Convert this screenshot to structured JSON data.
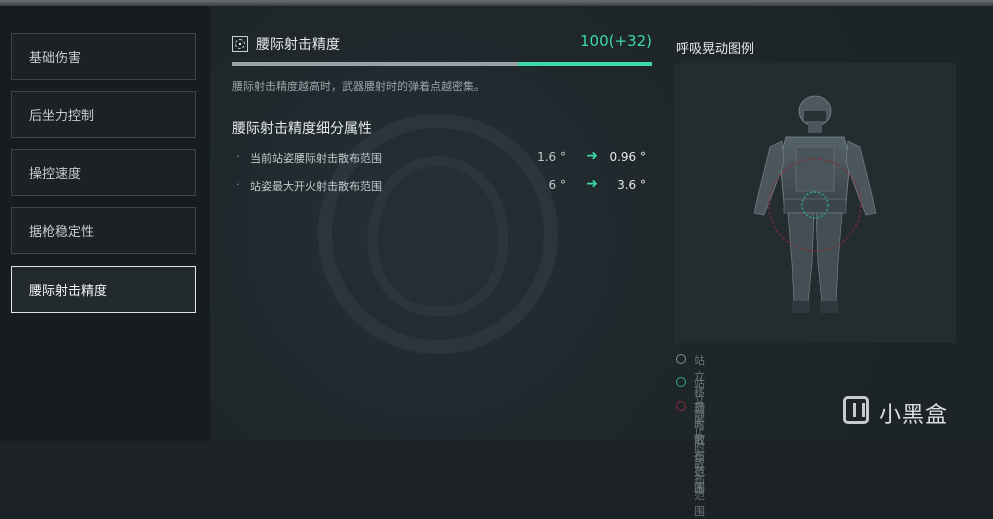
{
  "sidebar": {
    "items": [
      {
        "label": "基础伤害"
      },
      {
        "label": "后坐力控制"
      },
      {
        "label": "操控速度"
      },
      {
        "label": "据枪稳定性"
      },
      {
        "label": "腰际射击精度"
      }
    ],
    "active_index": 4
  },
  "stat": {
    "title": "腰际射击精度",
    "value": "100(+32)",
    "base_fraction": 0.68,
    "total_fraction": 1.0,
    "description": "腰际射击精度越高时，武器腰射时的弹着点越密集。"
  },
  "details": {
    "title": "腰际射击精度细分属性",
    "rows": [
      {
        "bullet": "·",
        "label": "当前站姿腰际射击散布范围",
        "old": "1.6 °",
        "arrow": "➜",
        "new": "0.96 °"
      },
      {
        "bullet": "·",
        "label": "站姿最大开火射击散布范围",
        "old": "6 °",
        "arrow": "➜",
        "new": "3.6 °"
      }
    ]
  },
  "legend": {
    "title": "呼吸晃动图例",
    "items": [
      {
        "label": "站立移动时散布范围",
        "color": "#8a9297"
      },
      {
        "label": "站立静止时散布范围",
        "color": "#2fa683"
      },
      {
        "label": "最大散布范围",
        "color": "#8a2b34"
      }
    ]
  },
  "watermark": {
    "text": "小黑盒"
  },
  "colors": {
    "accent": "#3ad9a6",
    "background": "#1c2226"
  }
}
